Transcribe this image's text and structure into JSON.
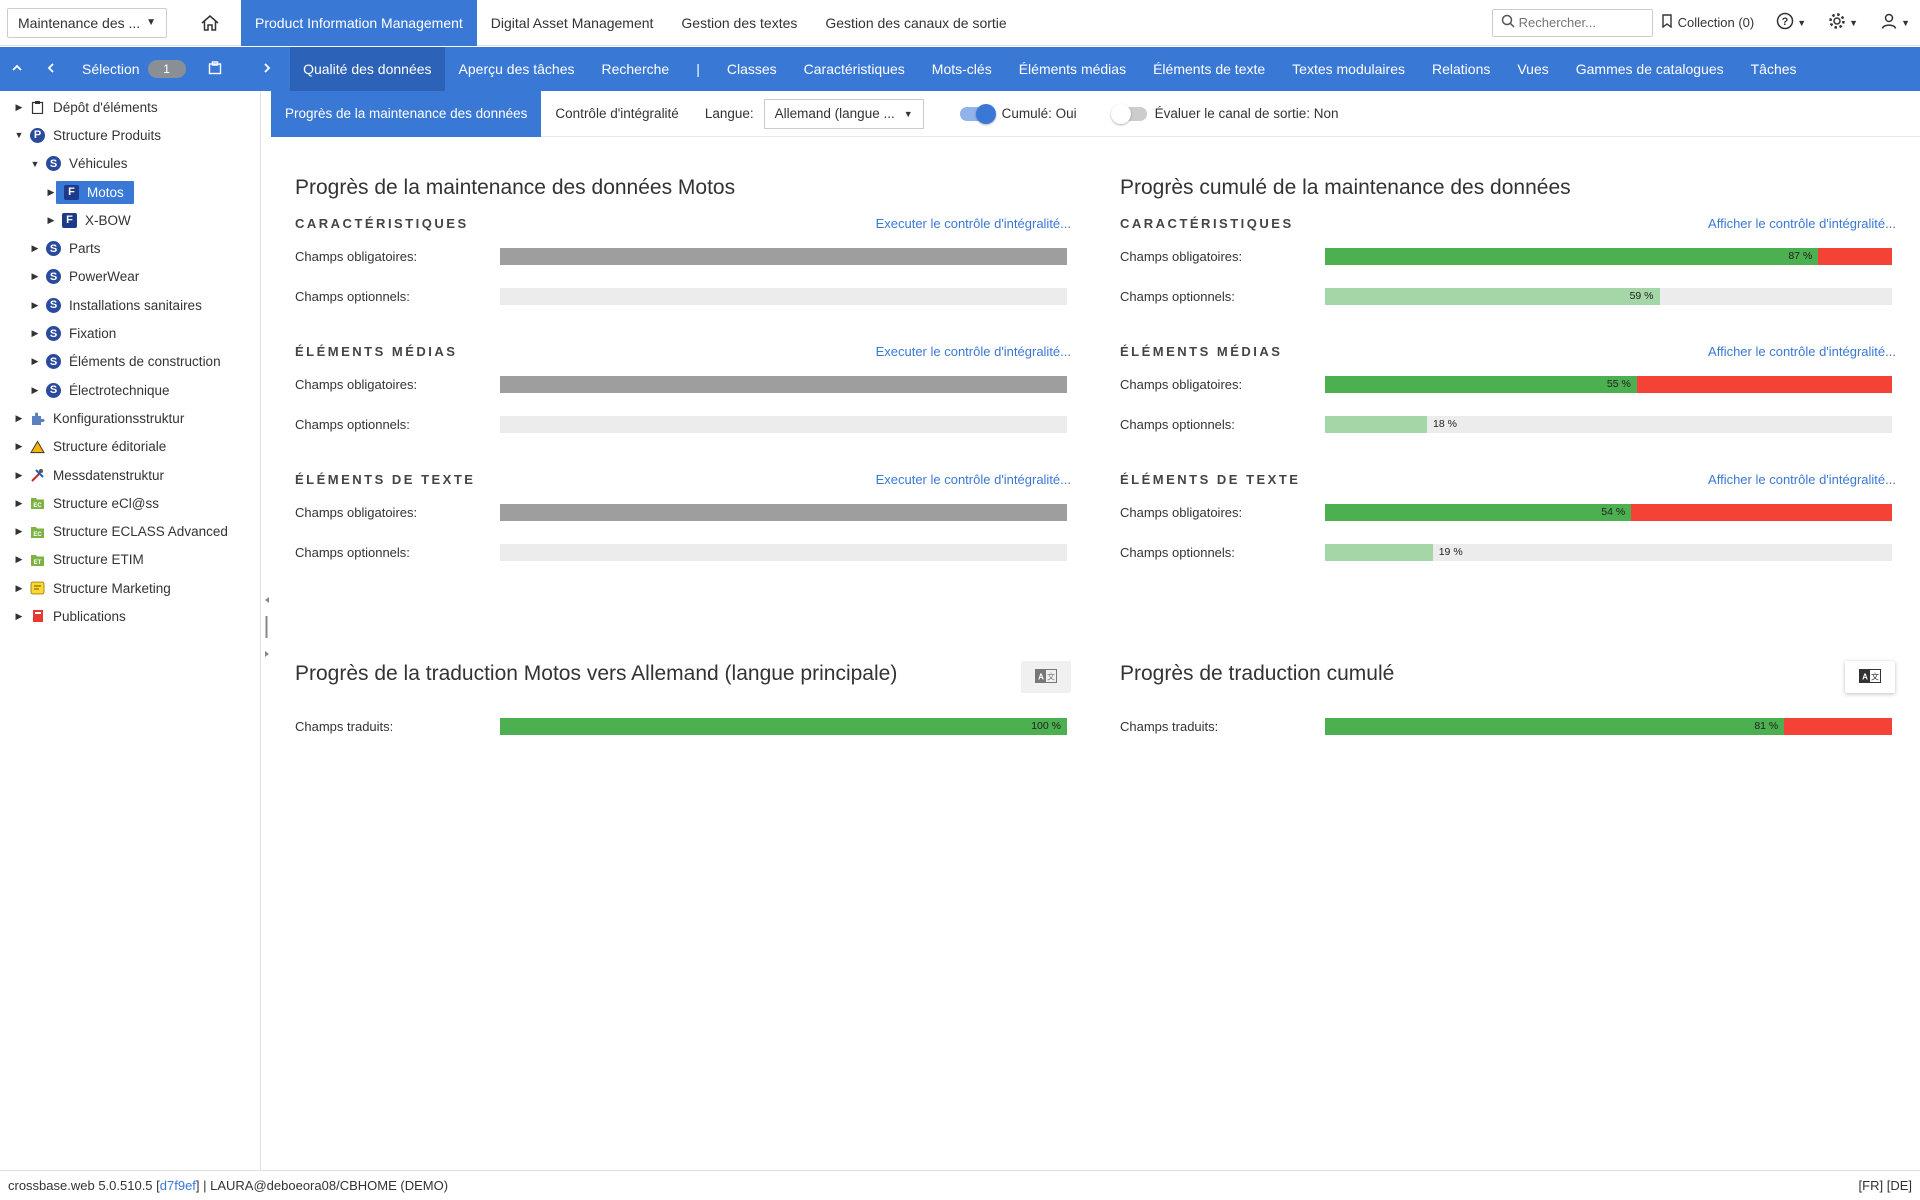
{
  "topbar": {
    "module": "Maintenance des ...",
    "app_tabs": [
      "Product Information Management",
      "Digital Asset Management",
      "Gestion des textes",
      "Gestion des canaux de sortie"
    ],
    "search_placeholder": "Rechercher...",
    "collection": "Collection (0)"
  },
  "navbar": {
    "selection_label": "Sélection",
    "selection_count": "1",
    "items": [
      "Qualité des données",
      "Aperçu des tâches",
      "Recherche",
      "|",
      "Classes",
      "Caractéristiques",
      "Mots-clés",
      "Éléments médias",
      "Éléments de texte",
      "Textes modulaires",
      "Relations",
      "Vues",
      "Gammes de catalogues",
      "Tâches"
    ]
  },
  "tree": [
    {
      "label": "Dépôt d'éléments",
      "icon": "clipboard-icon",
      "level": 0,
      "expanded": false
    },
    {
      "label": "Structure Produits",
      "icon": "P",
      "level": 0,
      "expanded": true
    },
    {
      "label": "Véhicules",
      "icon": "S",
      "level": 1,
      "expanded": true
    },
    {
      "label": "Motos",
      "icon": "F",
      "level": 2,
      "expanded": false,
      "selected": true
    },
    {
      "label": "X-BOW",
      "icon": "F",
      "level": 2,
      "expanded": false
    },
    {
      "label": "Parts",
      "icon": "S",
      "level": 1,
      "expanded": false
    },
    {
      "label": "PowerWear",
      "icon": "S",
      "level": 1,
      "expanded": false
    },
    {
      "label": "Installations sanitaires",
      "icon": "S",
      "level": 1,
      "expanded": false
    },
    {
      "label": "Fixation",
      "icon": "S",
      "level": 1,
      "expanded": false
    },
    {
      "label": "Éléments de construction",
      "icon": "S",
      "level": 1,
      "expanded": false
    },
    {
      "label": "Électrotechnique",
      "icon": "S",
      "level": 1,
      "expanded": false
    },
    {
      "label": "Konfigurationsstruktur",
      "icon": "puzzle-icon",
      "level": 0,
      "expanded": false
    },
    {
      "label": "Structure éditoriale",
      "icon": "warning-icon",
      "level": 0,
      "expanded": false
    },
    {
      "label": "Messdatenstruktur",
      "icon": "tools-icon",
      "level": 0,
      "expanded": false
    },
    {
      "label": "Structure eCl@ss",
      "icon": "folder-ec-icon",
      "level": 0,
      "expanded": false
    },
    {
      "label": "Structure ECLASS Advanced",
      "icon": "folder-ec-icon",
      "level": 0,
      "expanded": false
    },
    {
      "label": "Structure ETIM",
      "icon": "folder-et-icon",
      "level": 0,
      "expanded": false
    },
    {
      "label": "Structure Marketing",
      "icon": "marketing-icon",
      "level": 0,
      "expanded": false
    },
    {
      "label": "Publications",
      "icon": "book-icon",
      "level": 0,
      "expanded": false
    }
  ],
  "subbar": {
    "tab_progress": "Progrès de la maintenance des données",
    "tab_integrity": "Contrôle d'intégralité",
    "language_label": "Langue:",
    "language_value": "Allemand (langue ...",
    "cumulated": "Cumulé: Oui",
    "evaluate_channel": "Évaluer le canal de sortie: Non"
  },
  "left_panel": {
    "title": "Progrès de la maintenance des données Motos",
    "link": "Executer le contrôle d'intégralité...",
    "sections": [
      {
        "name": "CARACTÉRISTIQUES",
        "rows": [
          {
            "label": "Champs obligatoires:",
            "state": "gray"
          },
          {
            "label": "Champs optionnels:",
            "state": "empty"
          }
        ]
      },
      {
        "name": "ÉLÉMENTS MÉDIAS",
        "rows": [
          {
            "label": "Champs obligatoires:",
            "state": "gray"
          },
          {
            "label": "Champs optionnels:",
            "state": "empty"
          }
        ]
      },
      {
        "name": "ÉLÉMENTS DE TEXTE",
        "rows": [
          {
            "label": "Champs obligatoires:",
            "state": "gray"
          },
          {
            "label": "Champs optionnels:",
            "state": "empty"
          }
        ]
      }
    ]
  },
  "right_panel": {
    "title": "Progrès cumulé de la maintenance des données",
    "link": "Afficher le contrôle d'intégralité...",
    "sections": [
      {
        "name": "CARACTÉRISTIQUES",
        "rows": [
          {
            "label": "Champs obligatoires:",
            "value": 87,
            "label_text": "87 %",
            "kind": "required"
          },
          {
            "label": "Champs optionnels:",
            "value": 59,
            "label_text": "59 %",
            "kind": "optional"
          }
        ]
      },
      {
        "name": "ÉLÉMENTS MÉDIAS",
        "rows": [
          {
            "label": "Champs obligatoires:",
            "value": 55,
            "label_text": "55 %",
            "kind": "required"
          },
          {
            "label": "Champs optionnels:",
            "value": 18,
            "label_text": "18 %",
            "kind": "optional"
          }
        ]
      },
      {
        "name": "ÉLÉMENTS DE TEXTE",
        "rows": [
          {
            "label": "Champs obligatoires:",
            "value": 54,
            "label_text": "54 %",
            "kind": "required"
          },
          {
            "label": "Champs optionnels:",
            "value": 19,
            "label_text": "19 %",
            "kind": "optional"
          }
        ]
      }
    ]
  },
  "translation_left": {
    "title": "Progrès de la traduction Motos vers Allemand (langue principale)",
    "label": "Champs traduits:",
    "value": 100,
    "label_text": "100 %"
  },
  "translation_right": {
    "title": "Progrès de traduction cumulé",
    "label": "Champs traduits:",
    "value": 81,
    "label_text": "81 %"
  },
  "colors": {
    "accent": "#3a78d6",
    "green": "#4caf50",
    "light_green": "#a5d6a7",
    "red": "#f44336",
    "gray": "#9e9e9e"
  },
  "footer": {
    "prefix": "crossbase.web 5.0.510.5 [",
    "hash": "d7f9ef",
    "suffix": "] | LAURA@deboeora08/CBHOME (DEMO)",
    "langs": "[FR] [DE]"
  }
}
